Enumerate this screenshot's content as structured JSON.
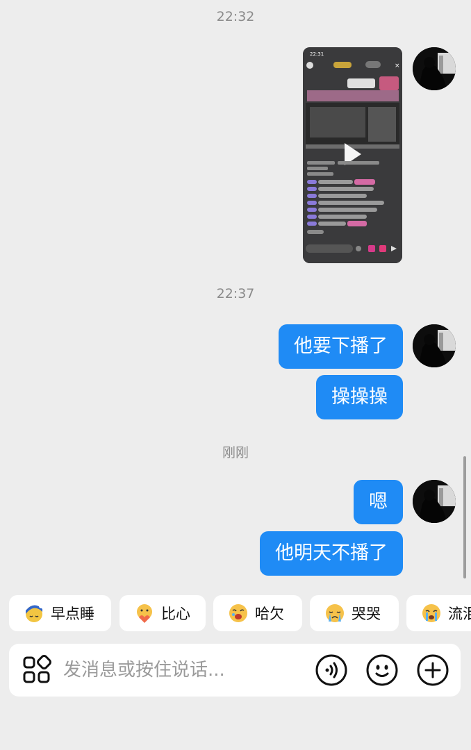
{
  "timestamps": [
    "22:32",
    "22:37",
    "刚刚"
  ],
  "video_preview": {
    "time": "22:31",
    "play_icon": "play-icon"
  },
  "messages": {
    "m1": "他要下播了",
    "m2": "操操操",
    "m3": "嗯",
    "m4": "他明天不播了"
  },
  "quick_replies": [
    "早点睡",
    "比心",
    "哈欠",
    "哭哭",
    "流泪"
  ],
  "input": {
    "placeholder": "发消息或按住说话..."
  },
  "icons": {
    "apps": "apps-grid-icon",
    "voice": "voice-icon",
    "emoji": "emoji-icon",
    "add": "plus-icon"
  },
  "colors": {
    "bubble": "#1f8bf5",
    "background": "#ededed"
  }
}
